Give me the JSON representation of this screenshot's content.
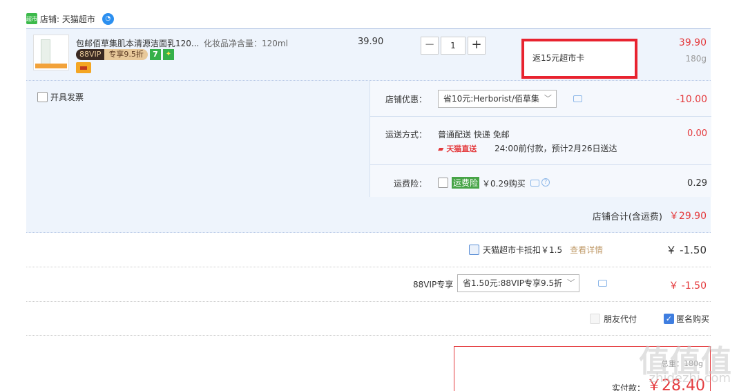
{
  "store": {
    "logo_text": "超市",
    "label": "店铺: 天猫超市",
    "ww_icon": "wangwang-icon"
  },
  "item": {
    "title": "包邮佰草集肌本清源洁面乳120...",
    "spec": "化妆品净含量：120ml",
    "vip_left": "88VIP",
    "vip_right": "专享9.5折",
    "badge_7": "7",
    "badge_g": "✦",
    "unit_price": "39.90",
    "quantity": "1",
    "minus": "−",
    "plus": "+",
    "promo": "返15元超市卡",
    "total": "39.90",
    "weight": "180g"
  },
  "options": {
    "invoice_label": "开具发票",
    "shop_discount_label": "店铺优惠：",
    "shop_discount_value": "省10元:Herborist/佰草集",
    "shop_discount_amount": "-10.00",
    "shipping_label": "运送方式：",
    "shipping_value": "普通配送 快递 免邮",
    "shipping_tag": "天猫直送",
    "shipping_eta": "24:00前付款，预计2月26日送达",
    "shipping_amount": "0.00",
    "insurance_label": "运费险：",
    "insurance_tag": "运费险",
    "insurance_text": "￥0.29购买",
    "insurance_amount": "0.29"
  },
  "store_total": {
    "label": "店铺合计(含运费)",
    "amount": "￥29.90"
  },
  "card_deduct": {
    "label": "天猫超市卡抵扣￥1.5",
    "link": "查看详情",
    "amount": "￥ -1.50"
  },
  "vip": {
    "label": "88VIP专享",
    "select": "省1.50元:88VIP专享9.5折",
    "amount": "￥ -1.50"
  },
  "extras": {
    "friend_pay": "朋友代付",
    "anonymous": "匿名购买"
  },
  "payment": {
    "weight_label": "总重：180g",
    "label": "实付款：",
    "amount": "￥28.40"
  },
  "watermark": {
    "main": "值值值",
    "sub": "zhidezhi.com"
  },
  "colors": {
    "accent_red": "#e4393c",
    "bg_blue": "#eef4fc",
    "promo_border": "#e8232f"
  }
}
